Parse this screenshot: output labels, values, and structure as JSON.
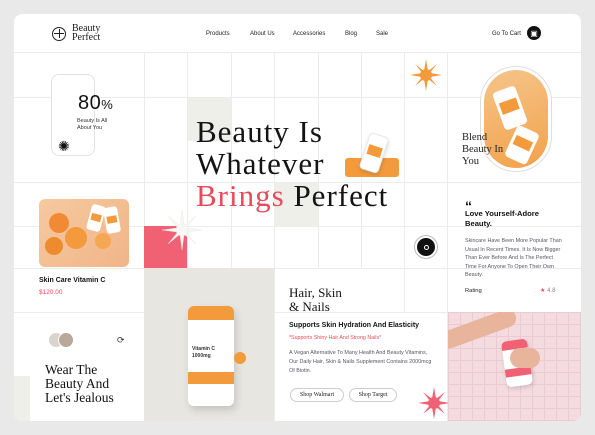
{
  "brand": {
    "line1": "Beauty",
    "line2": "Perfect"
  },
  "nav": {
    "items": [
      "Products",
      "About Us",
      "Accessories",
      "Blog",
      "Sale"
    ],
    "cart_label": "Go To Cart"
  },
  "stat": {
    "value": "80",
    "unit": "%",
    "label_line1": "Beauty Is All",
    "label_line2": "About You"
  },
  "hero": {
    "line1": "Beauty Is",
    "line2": "Whatever",
    "line3_accent": "Brings",
    "line3_rest": " Perfect"
  },
  "blend": {
    "line1": "Blend",
    "line2": "Beauty In",
    "line3": "You"
  },
  "testimonial": {
    "title_line1": "Love Yourself-Adore",
    "title_line2": "Beauty.",
    "body": "Skincare Have Been More Popular Than Usual In Recent Times. It Is Now Bigger Than Ever Before And Is The Perfect Time For Anyone To Open Their Own Beauty.",
    "rating_label": "Rating",
    "rating_value": "4.8"
  },
  "product": {
    "name": "Skin Care Vitamin C",
    "price": "$120.00"
  },
  "bottle": {
    "label_line1": "Vitamin C",
    "label_line2": "1000mg"
  },
  "feature": {
    "title_line1": "Hair, Skin",
    "title_line2": "& Nails",
    "subtitle": "Supports Skin Hydration And Elasticity",
    "note": "*Supports Shiny Hair And Strong Nails*",
    "body": "A Vegan Alternative To Many Health And Beauty Vitamins, Our Daily Hair, Skin & Nails Supplement Contains 2000mcg Of Biotin.",
    "btn_walmart": "Shop Walmart",
    "btn_target": "Shop Target"
  },
  "wear": {
    "line1": "Wear The",
    "line2": "Beauty And",
    "line3": "Let's Jealous"
  },
  "colors": {
    "accent": "#e84a5b",
    "orange": "#f39a3c",
    "pink": "#f06173"
  }
}
